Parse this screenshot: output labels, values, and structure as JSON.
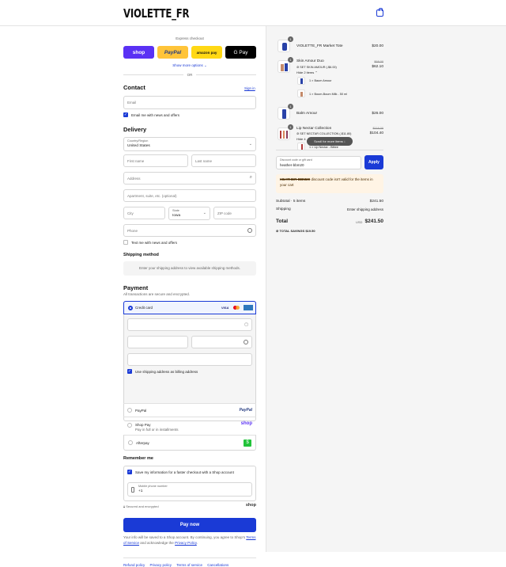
{
  "brand": {
    "logo": "VIOLETTE_FR"
  },
  "express": {
    "title": "Express checkout",
    "shop_label": "shop",
    "paypal_label": "PayPal",
    "amazon_label": "amazon pay",
    "gpay_label": "G Pay",
    "more": "Show more options ⌄",
    "or": "OR"
  },
  "contact": {
    "title": "Contact",
    "signin": "Sign in",
    "email_placeholder": "Email",
    "news_label": "Email me with news and offers"
  },
  "delivery": {
    "title": "Delivery",
    "country_label": "Country/Region",
    "country_value": "United States",
    "first_name": "First name",
    "last_name": "Last name",
    "address": "Address",
    "apartment": "Apartment, suite, etc. (optional)",
    "city": "City",
    "state_label": "State",
    "state_value": "Iowa",
    "zip": "ZIP code",
    "phone": "Phone",
    "text_label": "Text me with news and offers"
  },
  "shipping": {
    "title": "Shipping method",
    "note": "Enter your shipping address to view available shipping methods."
  },
  "payment": {
    "title": "Payment",
    "subtitle": "All transactions are secure and encrypted.",
    "credit_card": "Credit card",
    "billing_label": "Use shipping address as billing address",
    "paypal": "PayPal",
    "paypal_logo": "PayPal",
    "shoppay": "Shop Pay",
    "shoppay_sub": "Pay in full or in installments",
    "shoppay_logo": "shop",
    "afterpay": "Afterpay",
    "afterpay_logo": "$"
  },
  "remember": {
    "title": "Remember me",
    "save_label": "Save my information for a faster checkout with a Shop account",
    "mobile_label": "Mobile phone number",
    "mobile_value": "+1",
    "secure": "Secured and encrypted",
    "shop": "shop"
  },
  "pay_button": "Pay now",
  "legal": {
    "text1": "Your info will be saved to a Shop account. By continuing, you agree to Shop’s",
    "terms": "Terms of Service",
    "text2": "and acknowledge the",
    "privacy": "Privacy Policy",
    "text3": "."
  },
  "footer": [
    "Refund policy",
    "Privacy policy",
    "Terms of service",
    "Cancellations"
  ],
  "cart": {
    "items": [
      {
        "qty": "1",
        "name": "VIOLETTE_FR Market Tote",
        "price": "$20.00"
      },
      {
        "qty": "1",
        "name": "Skin Amour Duo",
        "discount": "SET SKIN AMOUR (-$6.00)",
        "orig": "$68.00",
        "price": "$62.10",
        "toggle": "Hide 2 items ⌃",
        "sub": [
          "1 × Baum Amour",
          "1 × Boum-Boum Milk - 50 ml"
        ]
      },
      {
        "qty": "1",
        "name": "Balm Amour",
        "price": "$26.00"
      },
      {
        "qty": "1",
        "name": "Lip Nectar Collection",
        "discount": "SET NECTAR COLLECTION (-$11.80)",
        "orig": "$116.00",
        "price": "$104.40",
        "toggle": "Hide 4",
        "sub": [
          "1 × Lip Nectar - Bittee"
        ]
      }
    ],
    "scroll_pill": "Scroll for more items ↓",
    "discount_label": "Discount code or gift card",
    "discount_value": "heather-bbm20",
    "apply": "Apply",
    "error_code": "HEATHER-BBM20",
    "error_text": "discount code isn't valid for the items in your cart",
    "subtotal_label": "Subtotal · 5 items",
    "subtotal_value": "$241.50",
    "shipping_label": "Shipping",
    "shipping_value": "Enter shipping address",
    "total_label": "Total",
    "currency": "USD",
    "total_value": "$241.50",
    "savings_label": "TOTAL SAVINGS",
    "savings_value": "$19.50"
  },
  "colors": {
    "accent": "#1a3ad6",
    "shop": "#5a31f4",
    "paypal": "#ffc439",
    "amazon": "#ffd814",
    "gpay": "#000000",
    "error_bg": "#fff4e5"
  }
}
